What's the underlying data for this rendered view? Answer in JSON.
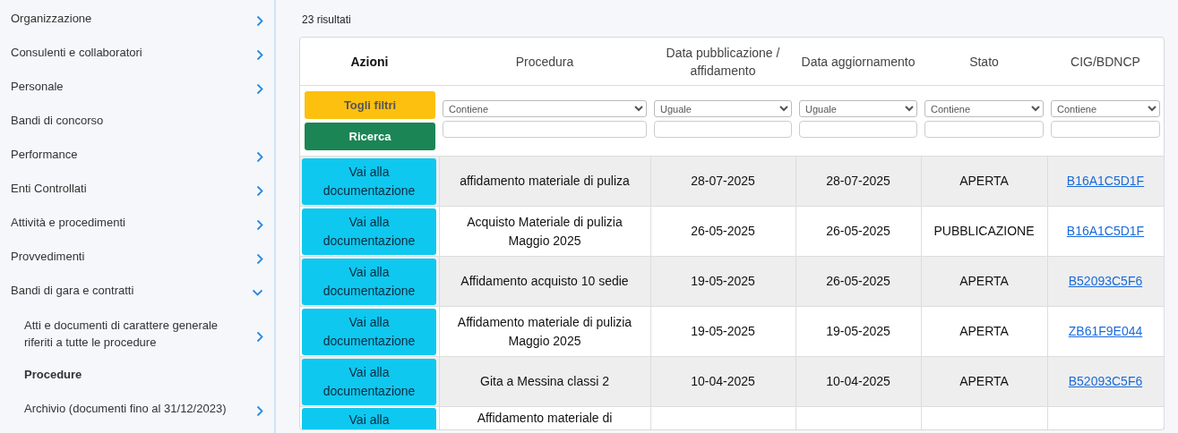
{
  "sidebar": {
    "items": [
      {
        "label": "Organizzazione",
        "kind": "group",
        "expanded": false,
        "selected": false
      },
      {
        "label": "Consulenti e collaboratori",
        "kind": "group",
        "expanded": false,
        "selected": false
      },
      {
        "label": "Personale",
        "kind": "group",
        "expanded": false,
        "selected": false
      },
      {
        "label": "Bandi di concorso",
        "kind": "link",
        "selected": false
      },
      {
        "label": "Performance",
        "kind": "group",
        "expanded": false,
        "selected": false
      },
      {
        "label": "Enti Controllati",
        "kind": "group",
        "expanded": false,
        "selected": false
      },
      {
        "label": "Attività e procedimenti",
        "kind": "group",
        "expanded": false,
        "selected": false
      },
      {
        "label": "Provvedimenti",
        "kind": "group",
        "expanded": false,
        "selected": false
      },
      {
        "label": "Bandi di gara e contratti",
        "kind": "group",
        "expanded": true,
        "selected": false,
        "children": [
          {
            "label": "Atti e documenti di carattere generale riferiti a tutte le procedure",
            "kind": "group",
            "expanded": false,
            "selected": false
          },
          {
            "label": "Procedure",
            "kind": "link",
            "selected": true
          },
          {
            "label": "Archivio (documenti fino al 31/12/2023)",
            "kind": "group",
            "expanded": false,
            "selected": false
          }
        ]
      }
    ]
  },
  "results_count": "23 risultati",
  "table": {
    "columns": [
      "Azioni",
      "Procedura",
      "Data pubblicazione / affidamento",
      "Data aggiornamento",
      "Stato",
      "CIG/BDNCP"
    ],
    "clear_filters_button": "Togli filtri",
    "search_button": "Ricerca",
    "filters": [
      {
        "operator": "Contiene"
      },
      {
        "operator": "Uguale"
      },
      {
        "operator": "Uguale"
      },
      {
        "operator": "Contiene"
      },
      {
        "operator": "Contiene"
      }
    ],
    "rows": [
      {
        "action": "Vai alla documentazione",
        "procedura": "affidamento materiale di puliza",
        "data_pubblicazione": "28-07-2025",
        "data_aggiornamento": "28-07-2025",
        "stato": "APERTA",
        "cig": "B16A1C5D1F"
      },
      {
        "action": "Vai alla documentazione",
        "procedura": "Acquisto Materiale di pulizia Maggio 2025",
        "data_pubblicazione": "26-05-2025",
        "data_aggiornamento": "26-05-2025",
        "stato": "PUBBLICAZIONE",
        "cig": "B16A1C5D1F"
      },
      {
        "action": "Vai alla documentazione",
        "procedura": "Affidamento acquisto 10 sedie",
        "data_pubblicazione": "19-05-2025",
        "data_aggiornamento": "26-05-2025",
        "stato": "APERTA",
        "cig": "B52093C5F6"
      },
      {
        "action": "Vai alla documentazione",
        "procedura": "Affidamento materiale di pulizia Maggio 2025",
        "data_pubblicazione": "19-05-2025",
        "data_aggiornamento": "19-05-2025",
        "stato": "APERTA",
        "cig": "ZB61F9E044"
      },
      {
        "action": "Vai alla documentazione",
        "procedura": "Gita a Messina classi 2",
        "data_pubblicazione": "10-04-2025",
        "data_aggiornamento": "10-04-2025",
        "stato": "APERTA",
        "cig": "B52093C5F6"
      },
      {
        "action": "Vai alla",
        "procedura": "Affidamento materiale di"
      }
    ]
  }
}
